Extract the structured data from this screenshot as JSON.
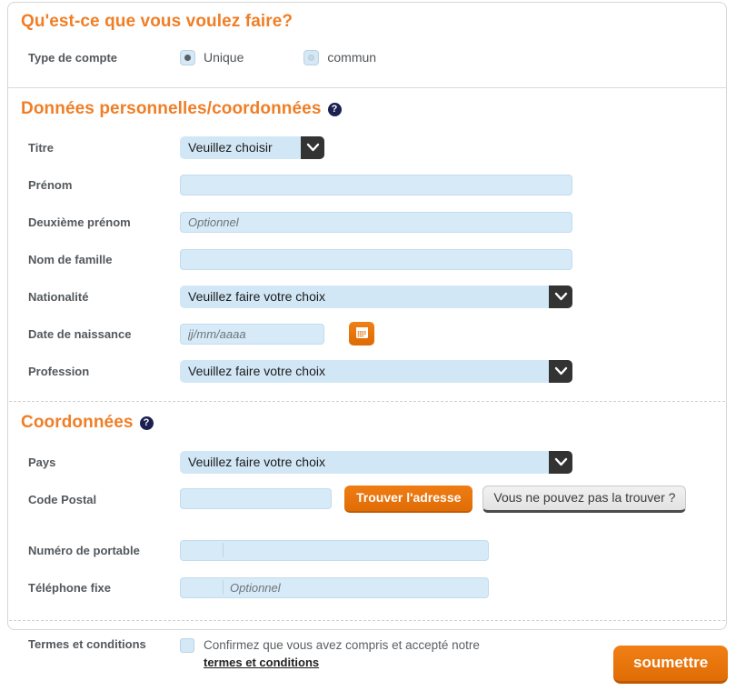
{
  "sections": {
    "account_type": {
      "title": "Qu'est-ce que vous voulez faire?",
      "label": "Type de compte",
      "options": [
        {
          "label": "Unique",
          "selected": true
        },
        {
          "label": "commun",
          "selected": false
        }
      ]
    },
    "personal": {
      "title": "Données personnelles/coordonnées",
      "help": "?",
      "fields": {
        "title_label": "Titre",
        "title_value": "Veuillez choisir",
        "firstname_label": "Prénom",
        "firstname_value": "",
        "firstname_placeholder": "",
        "middlename_label": "Deuxième prénom",
        "middlename_value": "",
        "middlename_placeholder": "Optionnel",
        "lastname_label": "Nom de famille",
        "lastname_value": "",
        "lastname_placeholder": "",
        "nationality_label": "Nationalité",
        "nationality_value": "Veuillez faire votre choix",
        "dob_label": "Date de naissance",
        "dob_value": "",
        "dob_placeholder": "jj/mm/aaaa",
        "calendar_icon": "calendar-icon",
        "profession_label": "Profession",
        "profession_value": "Veuillez faire votre choix"
      }
    },
    "contact": {
      "title": "Coordonnées",
      "help": "?",
      "fields": {
        "country_label": "Pays",
        "country_value": "Veuillez faire votre choix",
        "postal_label": "Code Postal",
        "postal_value": "",
        "postal_placeholder": "",
        "find_address_button": "Trouver l'adresse",
        "cannot_find_button": "Vous ne pouvez pas la trouver ?",
        "mobile_label": "Numéro de portable",
        "mobile_value": "",
        "mobile_placeholder": "",
        "landline_label": "Téléphone fixe",
        "landline_value": "",
        "landline_placeholder": "Optionnel"
      }
    },
    "terms": {
      "label": "Termes et conditions",
      "text": "Confirmez que vous avez compris et accepté notre",
      "link": "termes et conditions",
      "checked": false
    }
  },
  "submit": {
    "label": "soumettre"
  },
  "colors": {
    "accent_orange": "#f07e26",
    "field_blue": "#d6eaf8",
    "arrow_dark": "#333333",
    "help_navy": "#1b2050"
  }
}
